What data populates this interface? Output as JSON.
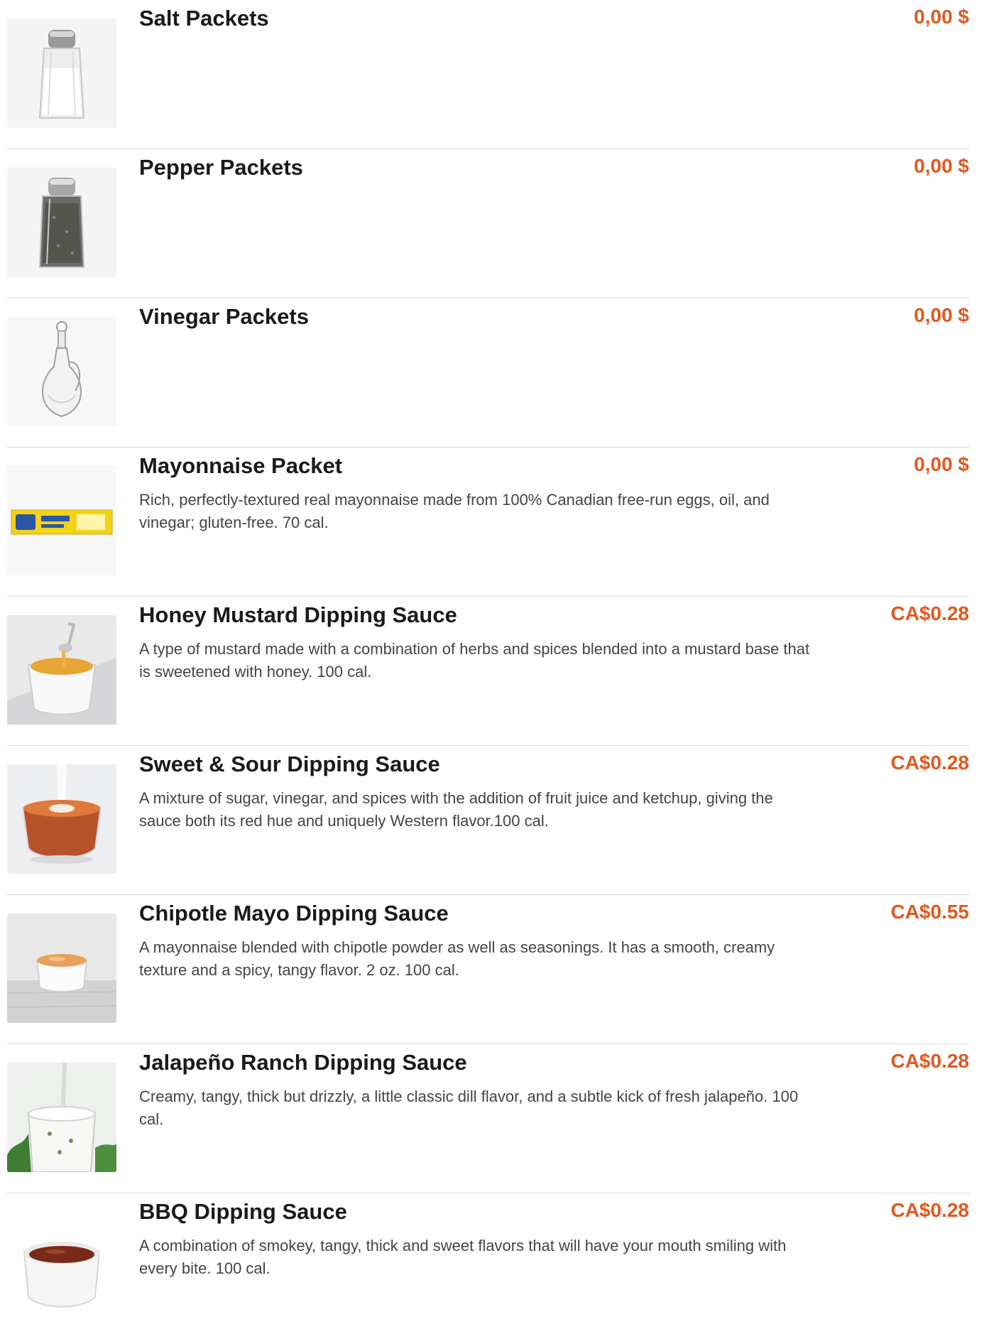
{
  "menu": {
    "items": [
      {
        "name": "Salt Packets",
        "price": "0,00 $",
        "description": "",
        "image": "salt-shaker-image"
      },
      {
        "name": "Pepper Packets",
        "price": "0,00 $",
        "description": "",
        "image": "pepper-shaker-image"
      },
      {
        "name": "Vinegar Packets",
        "price": "0,00 $",
        "description": "",
        "image": "vinegar-cruet-image"
      },
      {
        "name": "Mayonnaise Packet",
        "price": "0,00 $",
        "description": "Rich, perfectly-textured real mayonnaise made from 100% Canadian free-run eggs, oil, and vinegar; gluten-free. 70 cal.",
        "image": "mayonnaise-packet-image"
      },
      {
        "name": "Honey Mustard Dipping Sauce",
        "price": "CA$0.28",
        "description": "A type of mustard made with a combination of herbs and spices blended into a mustard base that is sweetened with honey. 100 cal.",
        "image": "honey-mustard-image"
      },
      {
        "name": "Sweet & Sour Dipping Sauce",
        "price": "CA$0.28",
        "description": "A mixture of sugar, vinegar, and spices with the addition of fruit juice and ketchup, giving the sauce both its red hue and uniquely Western flavor.100 cal.",
        "image": "sweet-sour-sauce-image"
      },
      {
        "name": "Chipotle Mayo Dipping Sauce",
        "price": "CA$0.55",
        "description": "A mayonnaise blended with chipotle powder as well as seasonings. It has a smooth, creamy texture and a spicy, tangy flavor. 2 oz. 100 cal.",
        "image": "chipotle-mayo-image"
      },
      {
        "name": "Jalapeño Ranch Dipping Sauce",
        "price": "CA$0.28",
        "description": "Creamy, tangy, thick but drizzly, a little classic dill flavor, and a subtle kick of fresh jalapeño. 100 cal.",
        "image": "jalapeno-ranch-image"
      },
      {
        "name": "BBQ Dipping Sauce",
        "price": "CA$0.28",
        "description": "A combination of smokey, tangy, thick and sweet flavors that will have your mouth smiling with every bite. 100 cal.",
        "image": "bbq-sauce-image"
      }
    ]
  },
  "colors": {
    "price": "#e2581f",
    "title": "#1a1a1a",
    "description": "#444444",
    "divider": "#d9d9d9"
  }
}
